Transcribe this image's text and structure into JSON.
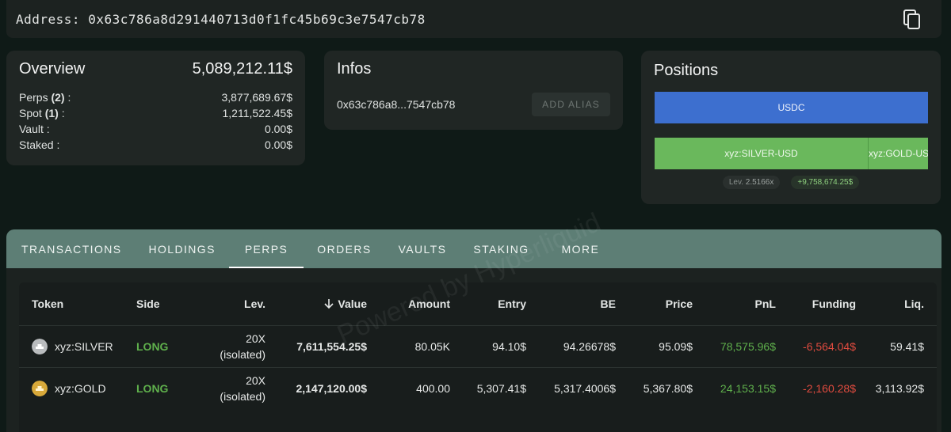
{
  "address": {
    "label": "Address:",
    "value": "0x63c786a8d291440713d0f1fc45b69c3e7547cb78"
  },
  "overview": {
    "title": "Overview",
    "total": "5,089,212.11$",
    "rows": [
      {
        "label": "Perps",
        "count": "(2)",
        "suffix": ":",
        "value": "3,877,689.67$"
      },
      {
        "label": "Spot",
        "count": "(1)",
        "suffix": ":",
        "value": "1,211,522.45$"
      },
      {
        "label": "Vault :",
        "value": "0.00$"
      },
      {
        "label": "Staked :",
        "value": "0.00$"
      }
    ]
  },
  "infos": {
    "title": "Infos",
    "short_address": "0x63c786a8...7547cb78",
    "add_alias_label": "ADD ALIAS"
  },
  "positions": {
    "title": "Positions",
    "bars": [
      "USDC",
      "xyz:SILVER-USD",
      "xyz:GOLD-USD"
    ],
    "lev_label": "Lev.",
    "lev_value": "2.5166x",
    "pnl": "+9,758,674.25$",
    "colors": {
      "usdc": "#3d6fcf",
      "asset": "#6ab85c"
    }
  },
  "tabs": [
    "TRANSACTIONS",
    "HOLDINGS",
    "PERPS",
    "ORDERS",
    "VAULTS",
    "STAKING",
    "MORE"
  ],
  "active_tab": "PERPS",
  "table": {
    "headers": {
      "token": "Token",
      "side": "Side",
      "lev": "Lev.",
      "value": "Value",
      "amount": "Amount",
      "entry": "Entry",
      "be": "BE",
      "price": "Price",
      "pnl": "PnL",
      "funding": "Funding",
      "liq": "Liq."
    },
    "rows": [
      {
        "token": "xyz:SILVER",
        "icon": "silver-token-icon",
        "side": "LONG",
        "lev_top": "20X",
        "lev_bottom": "(isolated)",
        "value": "7,611,554.25$",
        "amount": "80.05K",
        "entry": "94.10$",
        "be": "94.26678$",
        "price": "95.09$",
        "pnl": "78,575.96$",
        "funding": "-6,564.04$",
        "liq": "59.41$"
      },
      {
        "token": "xyz:GOLD",
        "icon": "gold-token-icon",
        "side": "LONG",
        "lev_top": "20X",
        "lev_bottom": "(isolated)",
        "value": "2,147,120.00$",
        "amount": "400.00",
        "entry": "5,307.41$",
        "be": "5,317.4006$",
        "price": "5,367.80$",
        "pnl": "24,153.15$",
        "funding": "-2,160.28$",
        "liq": "3,113.92$"
      }
    ]
  },
  "watermark": "Powered by Hyperliquid"
}
